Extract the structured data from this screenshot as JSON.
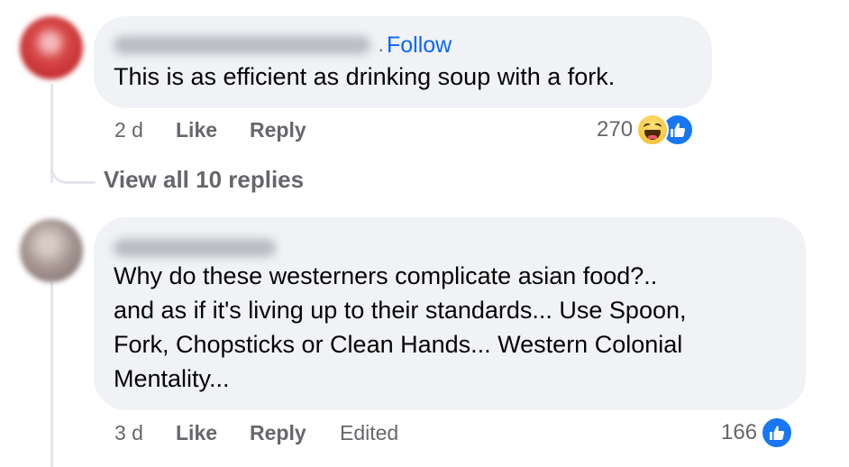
{
  "comments": [
    {
      "follow_separator": "·",
      "follow_label": "Follow",
      "text": "This is as efficient as drinking soup with a fork.",
      "time": "2 d",
      "like_label": "Like",
      "reply_label": "Reply",
      "reaction_count": "270",
      "reactions": [
        "haha-icon",
        "like-icon"
      ]
    },
    {
      "text": "Why do these westerners complicate asian food?..\nand as if it's living up to their standards... Use Spoon,\nFork, Chopsticks or Clean Hands... Western Colonial\nMentality...",
      "time": "3 d",
      "like_label": "Like",
      "reply_label": "Reply",
      "edited_label": "Edited",
      "reaction_count": "166",
      "reactions": [
        "like-icon"
      ]
    }
  ],
  "view_replies_label": "View all 10 replies",
  "colors": {
    "bubble": "#f0f2f5",
    "meta_text": "#65676b",
    "link_blue": "#0866ff",
    "like_blue": "#1877f2"
  }
}
